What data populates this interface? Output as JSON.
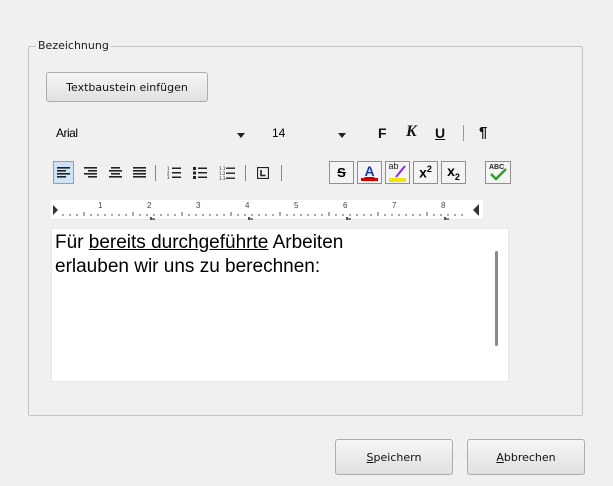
{
  "group": {
    "title": "Bezeichnung"
  },
  "insert_button": {
    "label": "Textbaustein einfügen"
  },
  "toolbar": {
    "font_name": "Arial",
    "font_size": "14",
    "bold": "F",
    "italic": "K",
    "underline": "U",
    "paragraph": "¶",
    "strikethrough": "S",
    "font_color_letter": "A",
    "highlight_letters": "ab",
    "superscript_base": "x",
    "superscript_exp": "2",
    "subscript_base": "x",
    "subscript_idx": "2",
    "spellcheck_label": "ABC",
    "icons": [
      "align-left-icon",
      "align-right-icon",
      "align-center-icon",
      "align-justify-icon",
      "numbered-list-icon",
      "bullet-list-icon",
      "multilevel-list-icon",
      "tab-stop-icon",
      "strikethrough-icon",
      "font-color-icon",
      "highlight-icon",
      "superscript-icon",
      "subscript-icon",
      "spellcheck-icon"
    ],
    "colors": {
      "font_color": "#d00000",
      "highlight": "#f2e600",
      "check": "#2e9e2e",
      "active_bg": "#cfe3f7"
    }
  },
  "ruler": {
    "numbers": [
      "1",
      "2",
      "3",
      "4",
      "5",
      "6",
      "7",
      "8"
    ]
  },
  "editor": {
    "line1_prefix": "Für ",
    "line1_underlined": "bereits durchgeführte",
    "line1_suffix": " Arbeiten",
    "line2": "erlauben wir uns zu berechnen:"
  },
  "footer": {
    "save": {
      "mnemonic": "S",
      "rest": "peichern"
    },
    "cancel": {
      "mnemonic": "A",
      "rest": "bbrechen"
    }
  }
}
